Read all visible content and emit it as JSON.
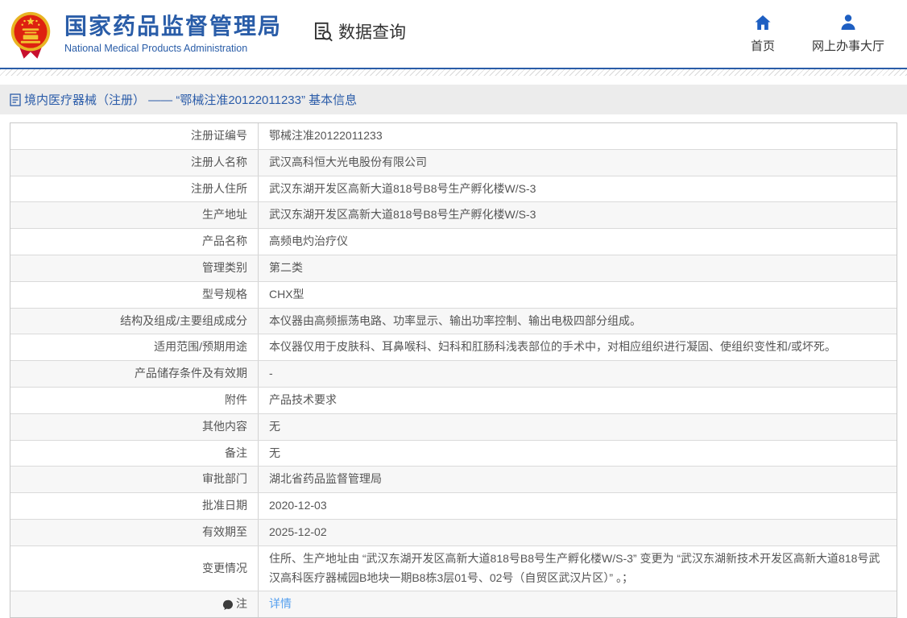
{
  "header": {
    "org_name_cn": "国家药品监督管理局",
    "org_name_en": "National Medical Products Administration",
    "section_label": "数据查询",
    "nav": [
      {
        "label": "首页",
        "icon": "home-icon"
      },
      {
        "label": "网上办事大厅",
        "icon": "person-icon"
      }
    ]
  },
  "breadcrumb": {
    "title": "境内医疗器械（注册） —— “鄂械注准20122011233” 基本信息"
  },
  "table": {
    "rows": [
      {
        "label": "注册证编号",
        "value": "鄂械注准20122011233"
      },
      {
        "label": "注册人名称",
        "value": "武汉高科恒大光电股份有限公司"
      },
      {
        "label": "注册人住所",
        "value": "武汉东湖开发区高新大道818号B8号生产孵化楼W/S-3"
      },
      {
        "label": "生产地址",
        "value": "武汉东湖开发区高新大道818号B8号生产孵化楼W/S-3"
      },
      {
        "label": "产品名称",
        "value": "高频电灼治疗仪"
      },
      {
        "label": "管理类别",
        "value": "第二类"
      },
      {
        "label": "型号规格",
        "value": "CHX型"
      },
      {
        "label": "结构及组成/主要组成成分",
        "value": "本仪器由高频振荡电路、功率显示、输出功率控制、输出电极四部分组成。"
      },
      {
        "label": "适用范围/预期用途",
        "value": "本仪器仅用于皮肤科、耳鼻喉科、妇科和肛肠科浅表部位的手术中，对相应组织进行凝固、使组织变性和/或坏死。"
      },
      {
        "label": "产品储存条件及有效期",
        "value": "-"
      },
      {
        "label": "附件",
        "value": "产品技术要求"
      },
      {
        "label": "其他内容",
        "value": "无"
      },
      {
        "label": "备注",
        "value": "无"
      },
      {
        "label": "审批部门",
        "value": "湖北省药品监督管理局"
      },
      {
        "label": "批准日期",
        "value": "2020-12-03"
      },
      {
        "label": "有效期至",
        "value": "2025-12-02"
      },
      {
        "label": "变更情况",
        "value": "住所、生产地址由 “武汉东湖开发区高新大道818号B8号生产孵化楼W/S-3” 变更为 “武汉东湖新技术开发区高新大道818号武汉高科医疗器械园B地块一期B8栋3层01号、02号（自贸区武汉片区）” 。；"
      },
      {
        "label": "注",
        "value": "详情",
        "value_is_link": true,
        "label_icon": "balloon-icon"
      }
    ]
  },
  "colors": {
    "brand_blue": "#2a5da8",
    "icon_blue": "#1e5fc2",
    "link_blue": "#56a0ef",
    "bar_gray": "#ececec",
    "row_alt_gray": "#f7f7f7",
    "emblem_red": "#de2110",
    "emblem_gold": "#e8b422"
  }
}
